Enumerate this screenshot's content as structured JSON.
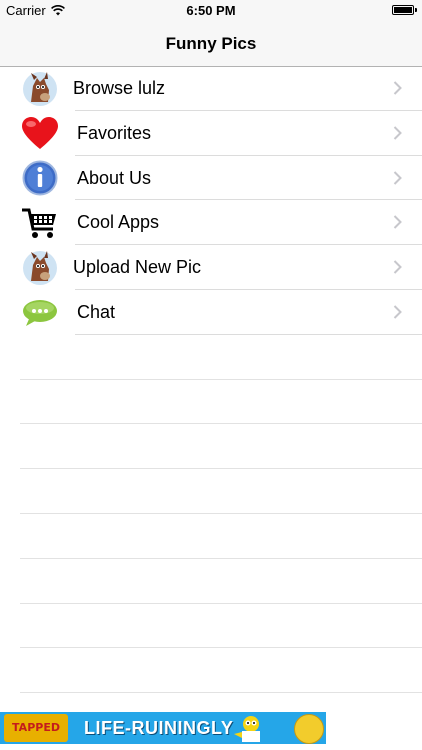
{
  "status_bar": {
    "carrier": "Carrier",
    "time": "6:50 PM"
  },
  "nav": {
    "title": "Funny Pics"
  },
  "menu": [
    {
      "label": "Browse lulz",
      "icon": "horse-icon"
    },
    {
      "label": "Favorites",
      "icon": "heart-icon"
    },
    {
      "label": "About Us",
      "icon": "info-icon"
    },
    {
      "label": "Cool Apps",
      "icon": "cart-icon"
    },
    {
      "label": "Upload New Pic",
      "icon": "horse-icon"
    },
    {
      "label": "Chat",
      "icon": "chat-bubble-icon"
    }
  ],
  "ad": {
    "logo": "TAPPED OUT",
    "text": "LIFE-RUININGLY"
  }
}
